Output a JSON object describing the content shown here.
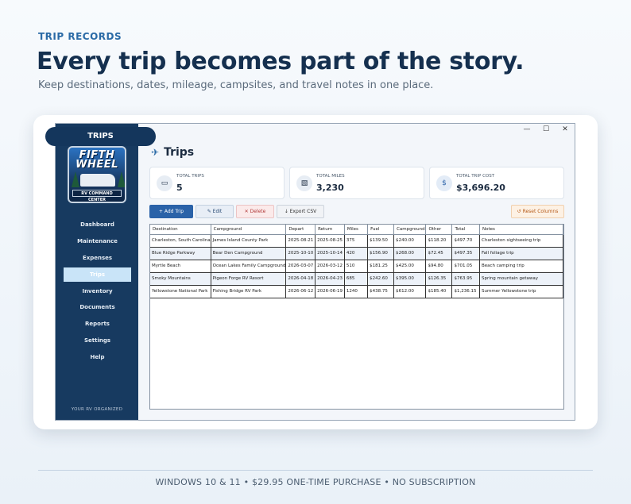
{
  "hero": {
    "eyebrow": "TRIP RECORDS",
    "headline": "Every trip becomes part of the story.",
    "subhead": "Keep destinations, dates, mileage, campsites, and travel notes in one place."
  },
  "pill_label": "TRIPS",
  "window": {
    "minimize": "—",
    "maximize": "☐",
    "close": "✕"
  },
  "sidebar": {
    "logo_line1": "FIFTH",
    "logo_line2": "WHEEL",
    "logo_banner": "RV COMMAND CENTER",
    "items": [
      {
        "label": "Dashboard",
        "active": false
      },
      {
        "label": "Maintenance",
        "active": false
      },
      {
        "label": "Expenses",
        "active": false
      },
      {
        "label": "Trips",
        "active": true
      },
      {
        "label": "Inventory",
        "active": false
      },
      {
        "label": "Documents",
        "active": false
      },
      {
        "label": "Reports",
        "active": false
      },
      {
        "label": "Settings",
        "active": false
      },
      {
        "label": "Help",
        "active": false
      }
    ],
    "footer": "YOUR RV ORGANIZED"
  },
  "page": {
    "title": "Trips",
    "icon": "airplane-icon"
  },
  "stats": [
    {
      "label": "TOTAL TRIPS",
      "value": "5",
      "icon": "rv-icon"
    },
    {
      "label": "TOTAL MILES",
      "value": "3,230",
      "icon": "map-icon"
    },
    {
      "label": "TOTAL TRIP COST",
      "value": "$3,696.20",
      "icon": "dollar-icon"
    }
  ],
  "toolbar": {
    "add": "+ Add Trip",
    "edit": "✎ Edit",
    "delete": "✕ Delete",
    "export": "↓ Export CSV",
    "reset": "↺ Reset Columns"
  },
  "table": {
    "columns": [
      "Destination",
      "Campground",
      "Depart",
      "Return",
      "Miles",
      "Fuel",
      "Campground",
      "Other",
      "Total",
      "Notes"
    ],
    "rows": [
      [
        "Charleston, South Carolina",
        "James Island County Park",
        "2025-08-21",
        "2025-08-25",
        "375",
        "$139.50",
        "$240.00",
        "$118.20",
        "$497.70",
        "Charleston sightseeing trip"
      ],
      [
        "Blue Ridge Parkway",
        "Bear Den Campground",
        "2025-10-10",
        "2025-10-14",
        "420",
        "$156.90",
        "$268.00",
        "$72.45",
        "$497.35",
        "Fall foliage trip"
      ],
      [
        "Myrtle Beach",
        "Ocean Lakes Family Campground",
        "2026-03-07",
        "2026-03-12",
        "510",
        "$181.25",
        "$425.00",
        "$94.80",
        "$701.05",
        "Beach camping trip"
      ],
      [
        "Smoky Mountains",
        "Pigeon Forge RV Resort",
        "2026-04-18",
        "2026-04-23",
        "685",
        "$242.60",
        "$395.00",
        "$126.35",
        "$763.95",
        "Spring mountain getaway"
      ],
      [
        "Yellowstone National Park",
        "Fishing Bridge RV Park",
        "2026-06-12",
        "2026-06-19",
        "1240",
        "$438.75",
        "$612.00",
        "$185.40",
        "$1,236.15",
        "Summer Yellowstone trip"
      ]
    ]
  },
  "footer": "WINDOWS 10 & 11  •  $29.95 ONE-TIME PURCHASE  •  NO SUBSCRIPTION"
}
